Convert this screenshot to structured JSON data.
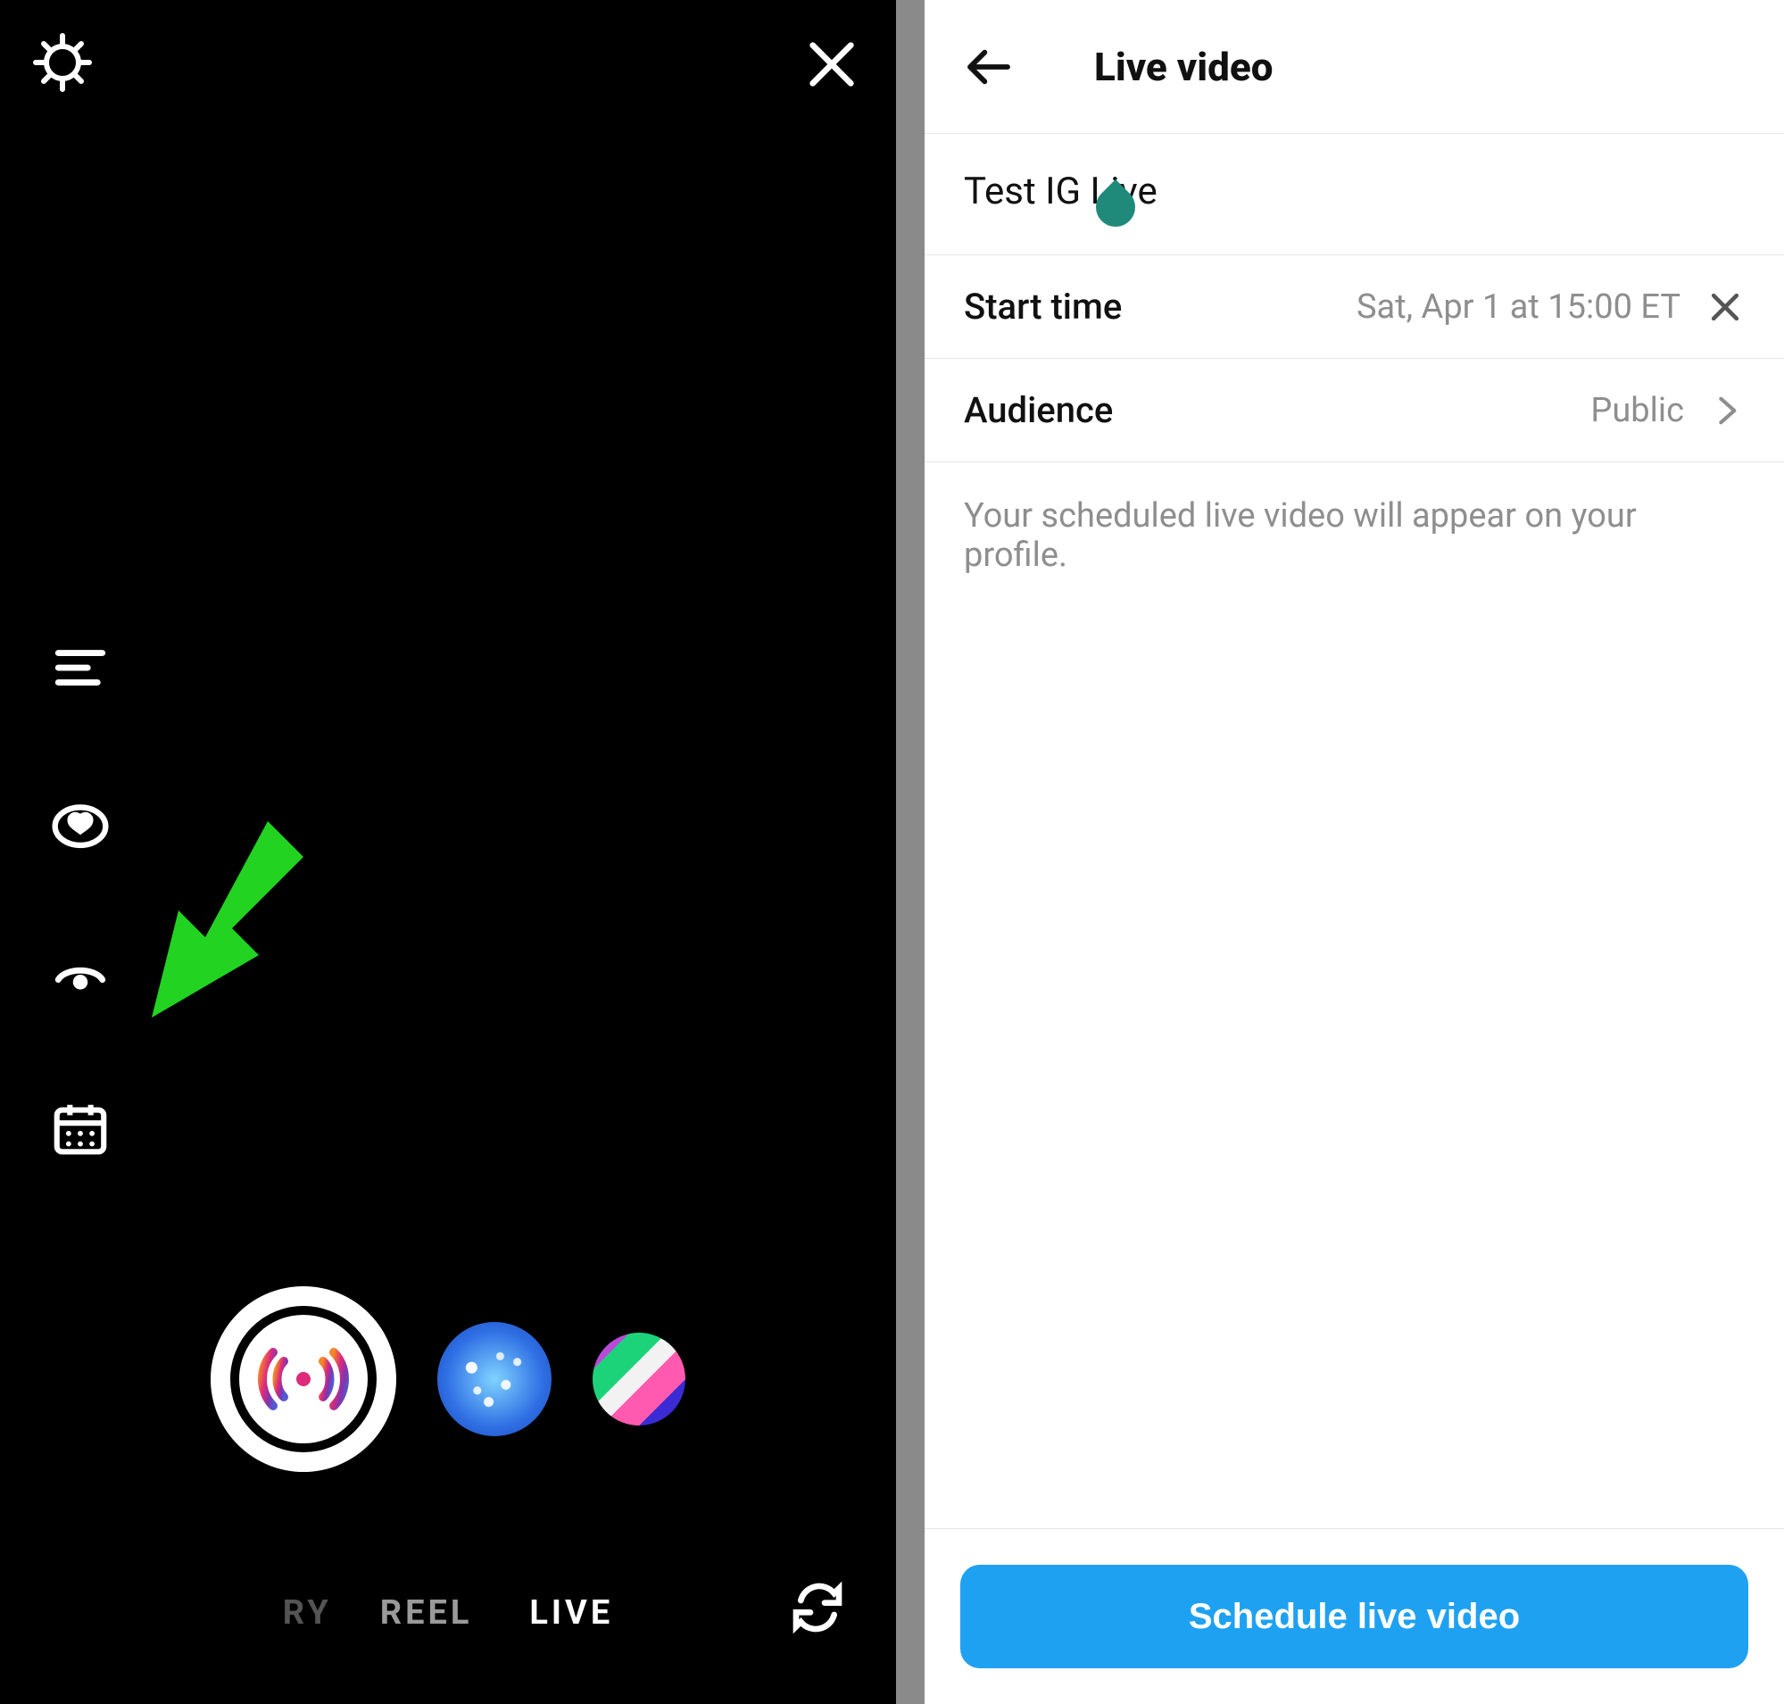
{
  "left": {
    "modes": {
      "partial_left": "RY",
      "reel": "REEL",
      "live": "LIVE"
    },
    "tools": {
      "title": "title-icon",
      "donate": "donate-heart-icon",
      "visibility": "visibility-eye-icon",
      "schedule": "schedule-calendar-icon"
    }
  },
  "right": {
    "header_title": "Live video",
    "title_value": "Test IG Live",
    "start_time_label": "Start time",
    "start_time_value": "Sat, Apr 1 at 15:00 ET",
    "audience_label": "Audience",
    "audience_value": "Public",
    "info_text": "Your scheduled live video will appear on your profile.",
    "schedule_button": "Schedule live video"
  }
}
